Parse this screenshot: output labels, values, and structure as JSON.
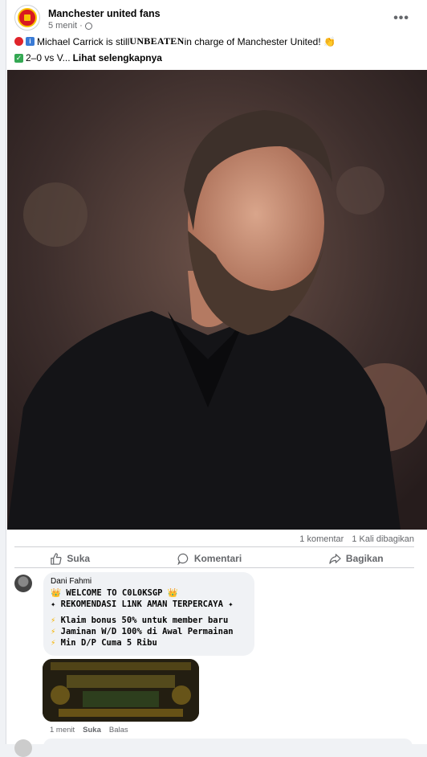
{
  "post": {
    "page_name": "Manchester united fans",
    "time": "5 menit",
    "more_label": "•••",
    "line1_pre": "Michael Carrick is still ",
    "line1_strong": "UNBEATEN",
    "line1_post": " in charge of Manchester United! 👏",
    "line2_text": "2–0 vs V... ",
    "line2_more": "Lihat selengkapnya"
  },
  "stats": {
    "comments": "1 komentar",
    "shares": "1 Kali dibagikan"
  },
  "actions": {
    "like": "Suka",
    "comment": "Komentari",
    "share": "Bagikan"
  },
  "comment": {
    "author": "Dani Fahmi",
    "lines": [
      "👑 WELCOME TO C0L0KSGP 👑",
      "✦ REKOMENDASI L1NK AMAN TERPERCAYA ✦",
      "Klaim bonus 50% untuk member baru",
      "Jaminan W/D 100% di Awal Permainan",
      "Min D/P Cuma 5 Ribu"
    ],
    "bolt": "⚡",
    "time": "1 menit",
    "like": "Suka",
    "reply": "Balas"
  },
  "colors": {
    "accent": "#1877f2",
    "muted": "#65676b",
    "bubble": "#f0f2f5"
  }
}
